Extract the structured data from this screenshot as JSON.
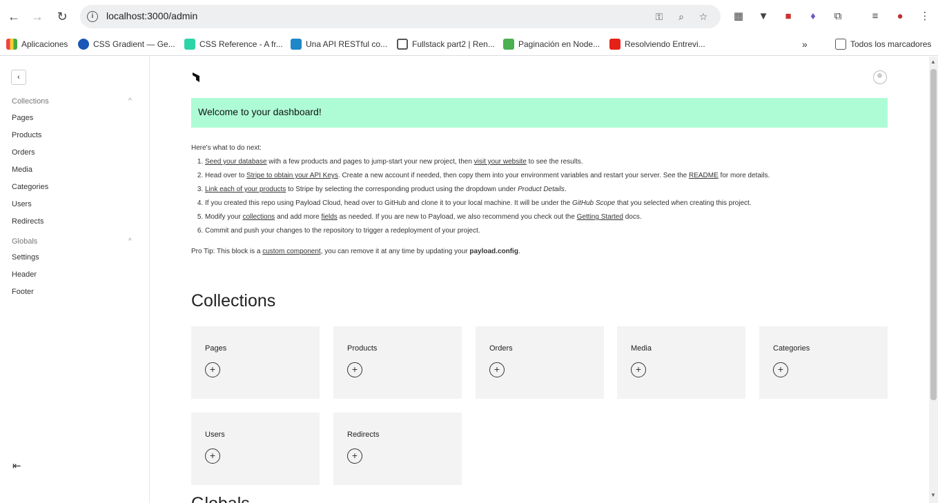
{
  "browser": {
    "url": "localhost:3000/admin",
    "bookmarks": [
      {
        "label": "Aplicaciones",
        "color": "#e44"
      },
      {
        "label": "CSS Gradient — Ge...",
        "color": "#1a56b8"
      },
      {
        "label": "CSS Reference - A fr...",
        "color": "#2dd4a8"
      },
      {
        "label": "Una API RESTful co...",
        "color": "#1e88c8"
      },
      {
        "label": "Fullstack part2 | Ren...",
        "color": "#555"
      },
      {
        "label": "Paginación en Node...",
        "color": "#4caf50"
      },
      {
        "label": "Resolviendo Entrevi...",
        "color": "#e62117"
      }
    ],
    "all_bookmarks": "Todos los marcadores"
  },
  "sidebar": {
    "collections_title": "Collections",
    "collections": [
      "Pages",
      "Products",
      "Orders",
      "Media",
      "Categories",
      "Users",
      "Redirects"
    ],
    "globals_title": "Globals",
    "globals": [
      "Settings",
      "Header",
      "Footer"
    ]
  },
  "dashboard": {
    "banner": "Welcome to your dashboard!",
    "intro": "Here's what to do next:",
    "steps": {
      "s1": {
        "a": "Seed your database",
        "b": " with a few products and pages to jump-start your new project, then ",
        "c": "visit your website",
        "d": " to see the results."
      },
      "s2": {
        "a": "Head over to ",
        "b": "Stripe to obtain your API Keys",
        "c": ". Create a new account if needed, then copy them into your environment variables and restart your server. See the ",
        "d": "README",
        "e": " for more details."
      },
      "s3": {
        "a": "Link each of your products",
        "b": " to Stripe by selecting the corresponding product using the dropdown under ",
        "c": "Product Details",
        "d": "."
      },
      "s4": {
        "a": "If you created this repo using Payload Cloud, head over to GitHub and clone it to your local machine. It will be under the ",
        "b": "GitHub Scope",
        "c": " that you selected when creating this project."
      },
      "s5": {
        "a": "Modify your ",
        "b": "collections",
        "c": " and add more ",
        "d": "fields",
        "e": " as needed. If you are new to Payload, we also recommend you check out the ",
        "f": "Getting Started",
        "g": " docs."
      },
      "s6": {
        "a": "Commit and push your changes to the repository to trigger a redeployment of your project."
      }
    },
    "protip": {
      "a": "Pro Tip: This block is a ",
      "b": "custom component",
      "c": ", you can remove it at any time by updating your ",
      "d": "payload.config",
      "e": "."
    },
    "collections_heading": "Collections",
    "cards": [
      "Pages",
      "Products",
      "Orders",
      "Media",
      "Categories",
      "Users",
      "Redirects"
    ],
    "add_symbol": "+",
    "globals_heading": "Globals"
  }
}
